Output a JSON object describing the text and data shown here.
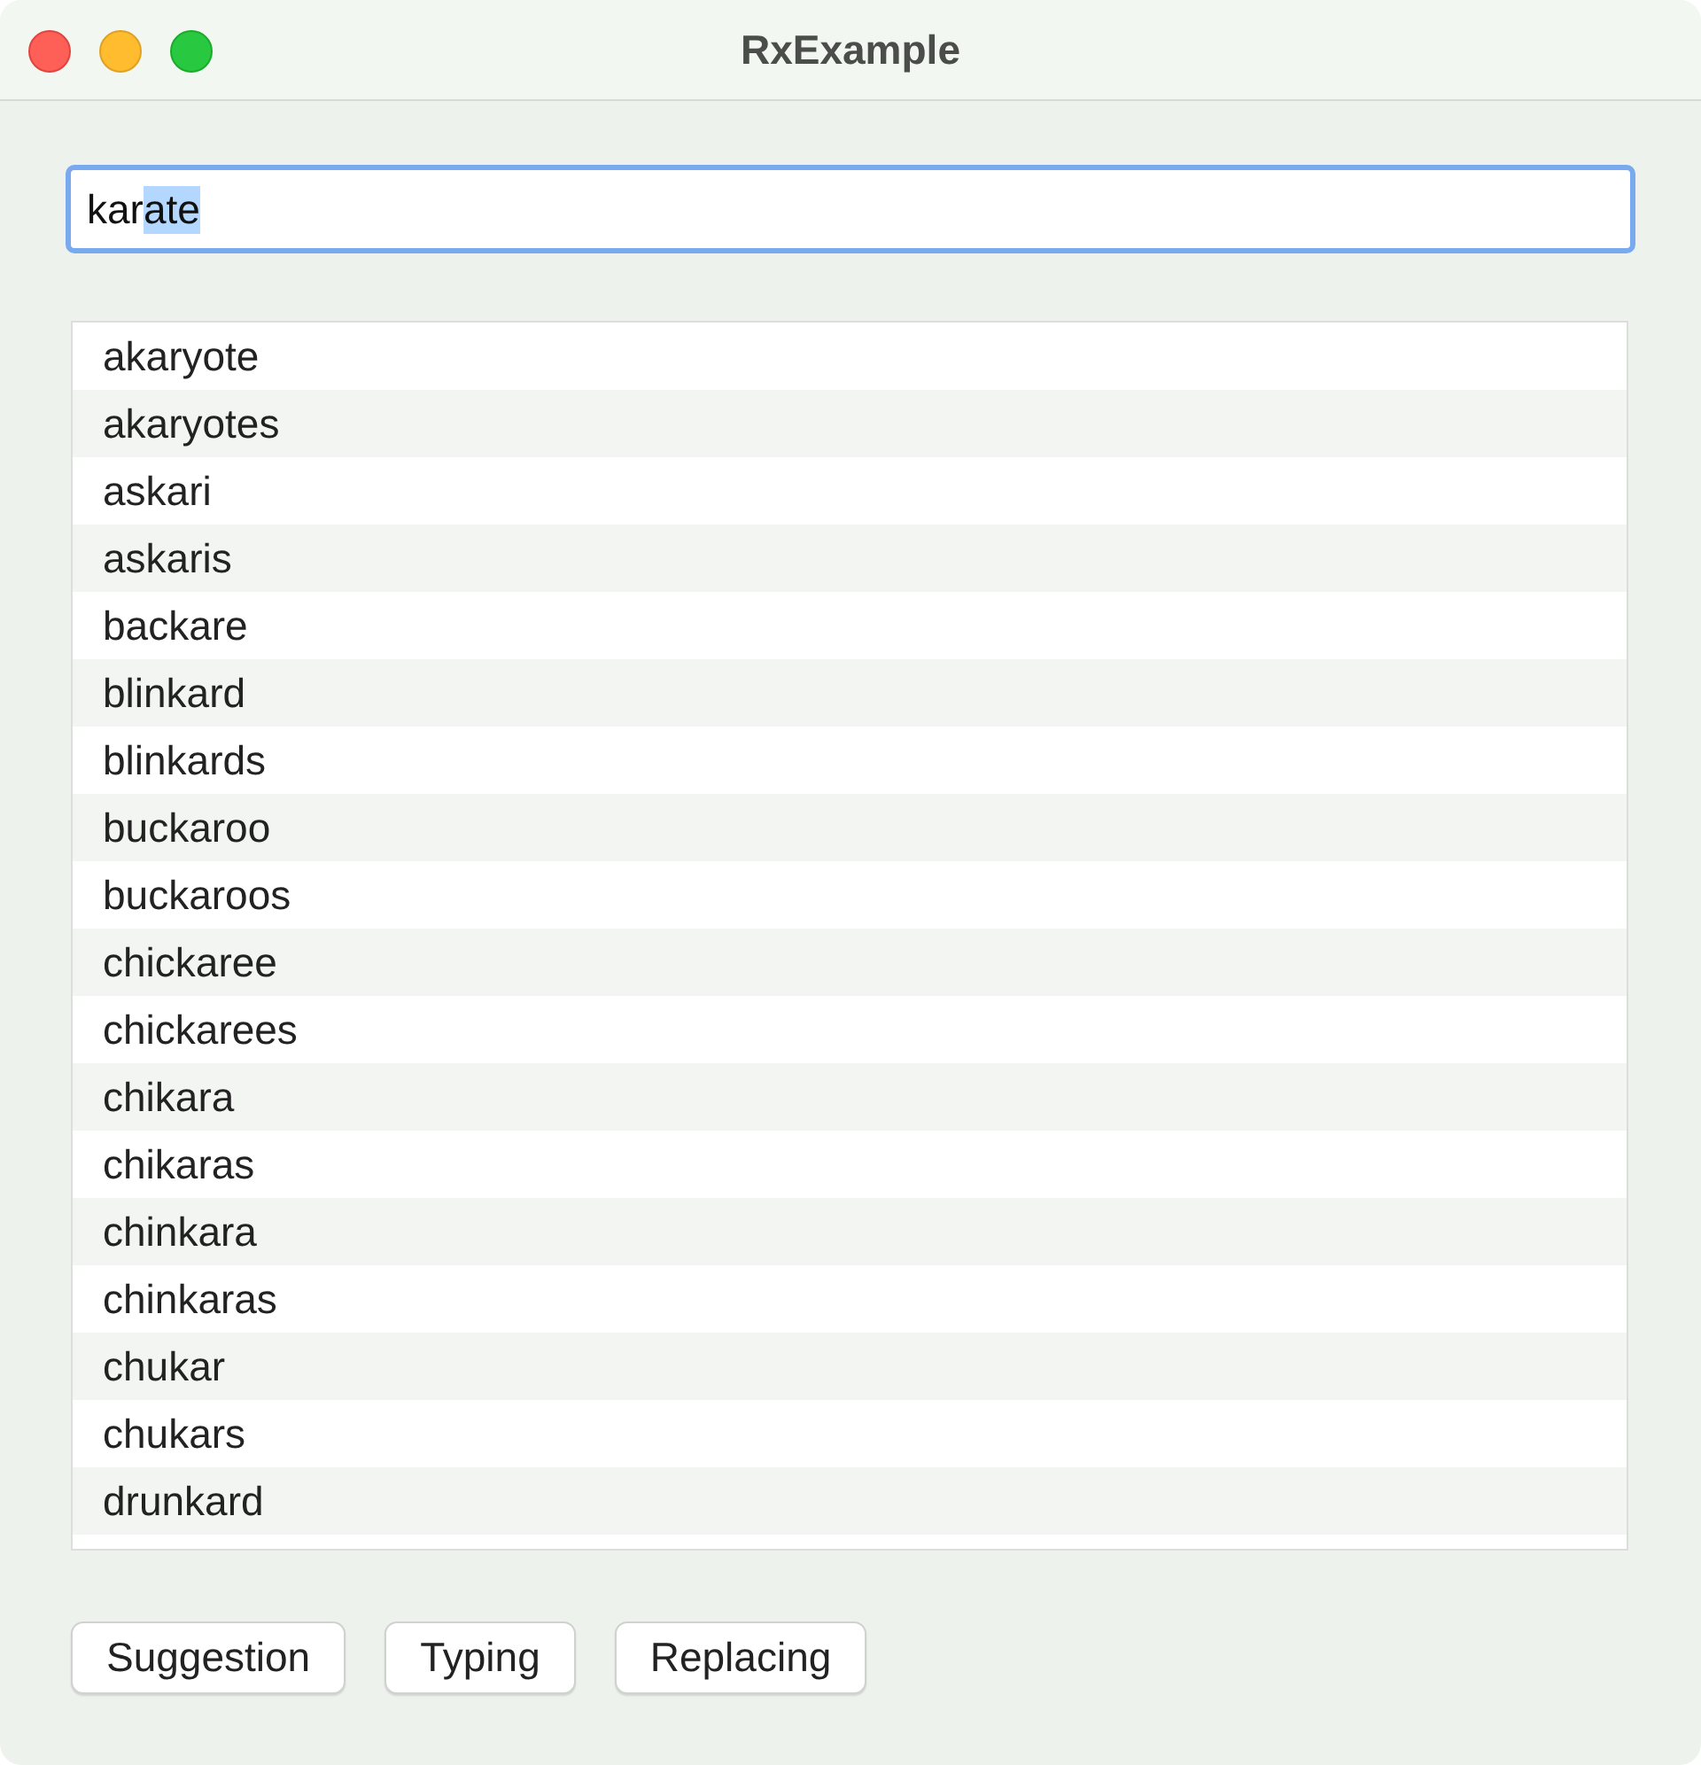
{
  "window": {
    "title": "RxExample"
  },
  "search": {
    "value": "kar",
    "selected_text": "ate"
  },
  "results": [
    "akaryote",
    "akaryotes",
    "askari",
    "askaris",
    "backare",
    "blinkard",
    "blinkards",
    "buckaroo",
    "buckaroos",
    "chickaree",
    "chickarees",
    "chikara",
    "chikaras",
    "chinkara",
    "chinkaras",
    "chukar",
    "chukars",
    "drunkard"
  ],
  "buttons": [
    "Suggestion",
    "Typing",
    "Replacing"
  ]
}
